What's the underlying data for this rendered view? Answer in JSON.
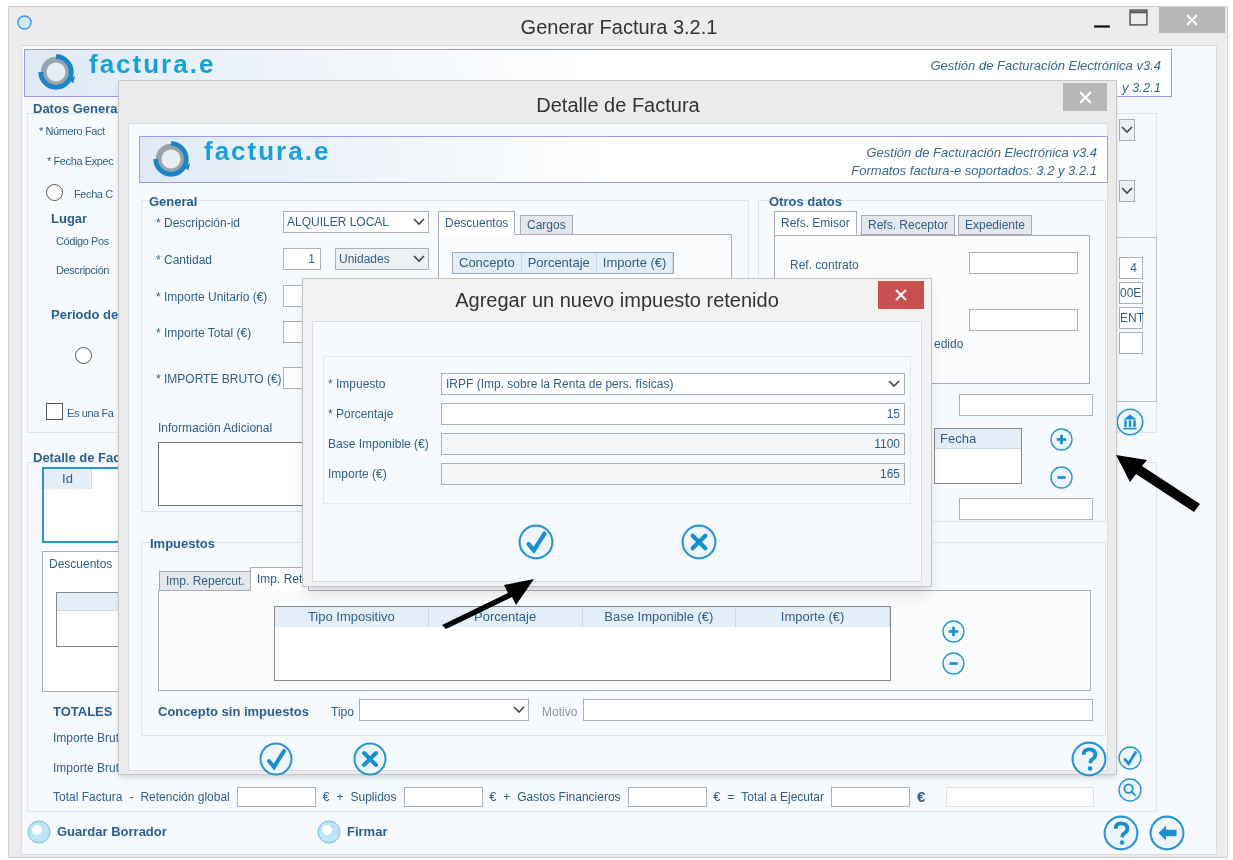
{
  "main_window": {
    "title": "Generar Factura 3.2.1",
    "header": {
      "logo": "factura.e",
      "subtitle": "Gestión de Facturación Electrónica v3.4",
      "formats": "y 3.2.1"
    },
    "datos_generales": {
      "title": "Datos Genera",
      "numero_label": "* Número Fact",
      "fecha_label": "* Fecha Expec",
      "fecha_radio": {
        "label": "Fecha C",
        "selected": false
      },
      "lugar_title": "Lugar",
      "lugar_labels": [
        "Código Pos",
        "Descripción"
      ],
      "periodo_title": "Periodo de",
      "periodo_radio": {
        "selected": false
      },
      "factura_check": {
        "label": "Es una Fa",
        "checked": false
      }
    },
    "right_fields": [
      "4",
      "00E",
      "ENT"
    ],
    "detalle": {
      "title": "Detalle de Fac",
      "columns": [
        "Id"
      ],
      "tab": "Descuentos"
    },
    "totales": {
      "title": "TOTALES",
      "labels": [
        "Importe Brut",
        "Importe Brut"
      ],
      "row": [
        {
          "kind": "text",
          "text": "Total Factura"
        },
        {
          "kind": "text",
          "text": "-"
        },
        {
          "kind": "text",
          "text": "Retención global"
        },
        {
          "kind": "field"
        },
        {
          "kind": "text",
          "text": "€"
        },
        {
          "kind": "text",
          "text": "+"
        },
        {
          "kind": "text",
          "text": "Suplidos"
        },
        {
          "kind": "field"
        },
        {
          "kind": "text",
          "text": "€"
        },
        {
          "kind": "text",
          "text": "+"
        },
        {
          "kind": "text",
          "text": "Gastos Financieros"
        },
        {
          "kind": "field"
        },
        {
          "kind": "text",
          "text": "€"
        },
        {
          "kind": "text",
          "text": "="
        },
        {
          "kind": "text",
          "text": "Total a Ejecutar"
        },
        {
          "kind": "field"
        },
        {
          "kind": "euro",
          "text": "€"
        },
        {
          "kind": "wide_field"
        }
      ]
    },
    "actions": [
      "Guardar Borrador",
      "Firmar"
    ]
  },
  "detail_window": {
    "title": "Detalle de Factura",
    "header": {
      "logo": "factura.e",
      "subtitle": "Gestión de Facturación Electrónica v3.4",
      "formats": "Formatos factura-e soportados: 3.2 y 3.2.1"
    },
    "general": {
      "title": "General",
      "fields": [
        {
          "label": "* Descripción-id",
          "kind": "select",
          "value": "ALQUILER LOCAL"
        },
        {
          "label": "* Cantidad",
          "kind": "quantity",
          "value": "1",
          "unit": "Unidades"
        },
        {
          "label": "* Importe Unitario (€)",
          "kind": "input"
        },
        {
          "label": "* Importe Total (€)",
          "kind": "input"
        },
        {
          "label": "* IMPORTE BRUTO (€)",
          "kind": "input"
        }
      ],
      "info_label": "Información Adicional"
    },
    "adjust_tabs": [
      {
        "label": "Descuentos",
        "selected": true
      },
      {
        "label": "Cargos",
        "selected": false
      }
    ],
    "adjust_columns": [
      "Concepto",
      "Porcentaje",
      "Importe (€)"
    ],
    "otros_datos": {
      "title": "Otros datos",
      "tabs": [
        {
          "label": "Refs. Emisor",
          "selected": true
        },
        {
          "label": "Refs. Receptor",
          "selected": false
        },
        {
          "label": "Expediente",
          "selected": false
        }
      ],
      "ref_contrato": "Ref. contrato",
      "pedido_label": "edido",
      "fecha_column": "Fecha"
    },
    "impuestos": {
      "title": "Impuestos",
      "tabs": [
        {
          "label": "Imp. Repercut.",
          "selected": false
        },
        {
          "label": "Imp. Ret",
          "selected": true
        }
      ],
      "columns": [
        "Tipo Impositivo",
        "Porcentaje",
        "Base Imponible (€)",
        "Importe (€)"
      ]
    },
    "concepto": {
      "title": "Concepto sin impuestos",
      "tipo_label": "Tipo",
      "motivo_label": "Motivo"
    }
  },
  "tax_dialog": {
    "title": "Agregar un nuevo impuesto retenido",
    "fields": [
      {
        "label": "* Impuesto",
        "kind": "select",
        "value": "IRPF (Imp. sobre la Renta de pers. físicas)"
      },
      {
        "label": "* Porcentaje",
        "kind": "input",
        "value": "15"
      },
      {
        "label": "Base Imponible (€)",
        "kind": "readonly",
        "value": "1100"
      },
      {
        "label": "Importe (€)",
        "kind": "readonly",
        "value": "165"
      }
    ]
  }
}
